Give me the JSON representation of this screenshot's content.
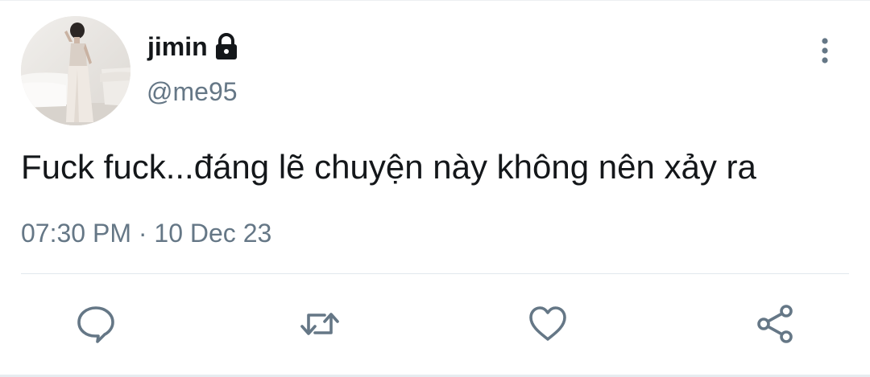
{
  "tweet": {
    "author": {
      "display_name": "jimin",
      "handle": "@me95",
      "protected_icon": "lock-icon"
    },
    "text": "Fuck fuck...đáng lẽ chuyện này không nên xảy ra",
    "time": "07:30 PM",
    "separator": "·",
    "date": "10 Dec 23",
    "timestamp_line": "07:30 PM · 10 Dec 23"
  },
  "actions": [
    {
      "name": "reply",
      "icon": "speech-bubble-icon"
    },
    {
      "name": "retweet",
      "icon": "retweet-arrows-icon"
    },
    {
      "name": "like",
      "icon": "heart-icon"
    },
    {
      "name": "share",
      "icon": "share-nodes-icon"
    }
  ],
  "menu": {
    "icon": "vertical-dots-icon"
  },
  "colors": {
    "text_primary": "#14171a",
    "text_secondary": "#657786",
    "icon_gray": "#657786",
    "divider": "#e1e8ed",
    "background": "#ffffff"
  }
}
